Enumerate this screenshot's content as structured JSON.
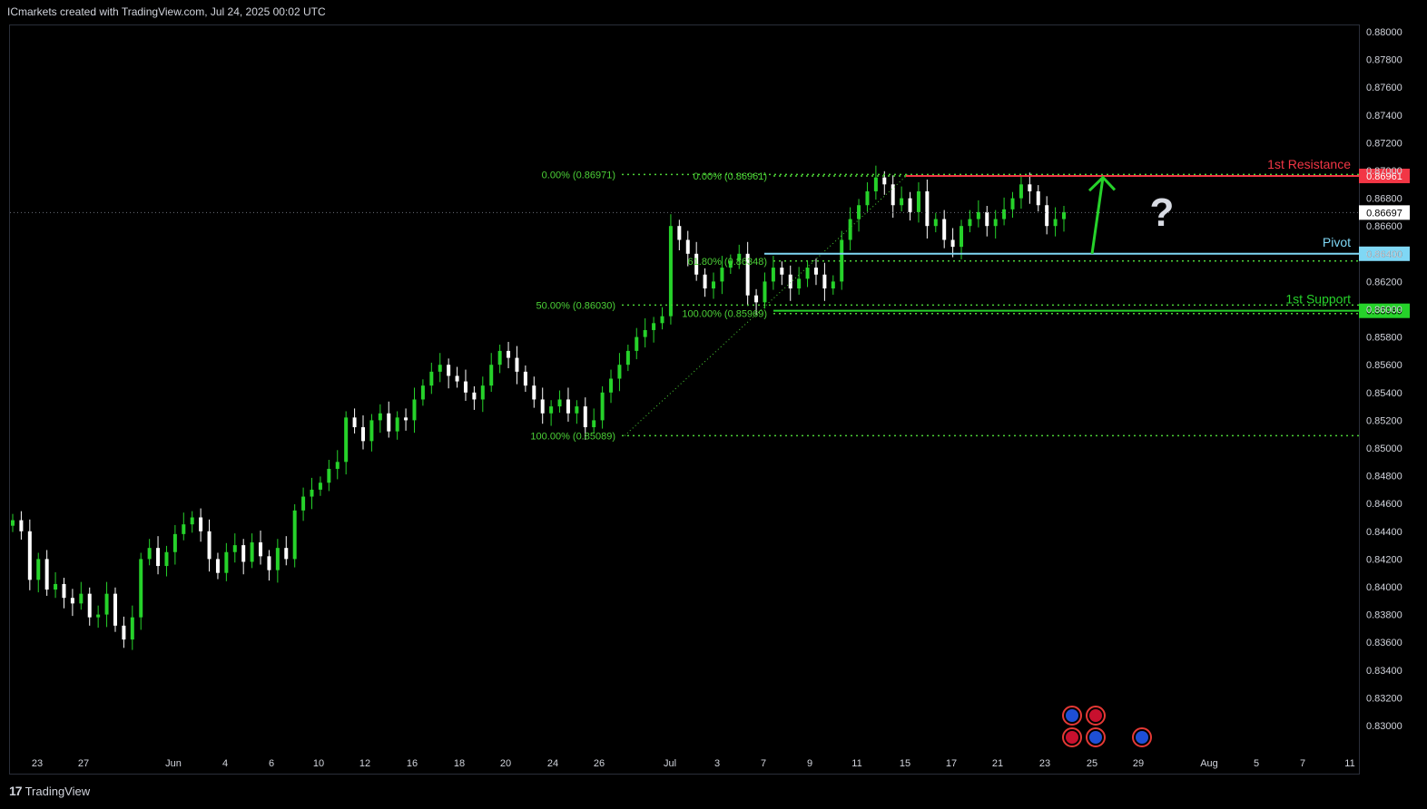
{
  "header": {
    "attribution": "ICmarkets created with TradingView.com, Jul 24, 2025 00:02 UTC"
  },
  "footer": {
    "brand": "TradingView",
    "logo_glyph": "17"
  },
  "colors": {
    "up": "#26d22a",
    "down": "#ffffff",
    "resistance": "#f23645",
    "pivot": "#7fd7f5",
    "support": "#26d22a",
    "fib": "#4cd137",
    "grid": "#2a2e39",
    "background": "#000000"
  },
  "chart_data": {
    "type": "candlestick",
    "title": "",
    "xlabel": "",
    "ylabel": "",
    "y_ticks": [
      "0.88000",
      "0.87800",
      "0.87600",
      "0.87400",
      "0.87200",
      "0.87000",
      "0.86800",
      "0.86600",
      "0.86400",
      "0.86200",
      "0.86000",
      "0.85800",
      "0.85600",
      "0.85400",
      "0.85200",
      "0.85000",
      "0.84800",
      "0.84600",
      "0.84400",
      "0.84200",
      "0.84000",
      "0.83800",
      "0.83600",
      "0.83400",
      "0.83200",
      "0.83000"
    ],
    "x_ticks": [
      "23",
      "27",
      "Jun",
      "4",
      "6",
      "10",
      "12",
      "16",
      "18",
      "20",
      "24",
      "26",
      "Jul",
      "3",
      "7",
      "9",
      "11",
      "15",
      "17",
      "21",
      "23",
      "25",
      "29",
      "Aug",
      "5",
      "7",
      "11"
    ],
    "ylim": [
      0.8293,
      0.8802
    ],
    "current_price": "0.86697",
    "levels": [
      {
        "name": "1st Resistance",
        "price": 0.86961,
        "label": "0.86961",
        "color": "resistance"
      },
      {
        "name": "Pivot",
        "price": 0.864,
        "label": "0.86400",
        "color": "pivot"
      },
      {
        "name": "1st Support",
        "price": 0.85989,
        "label": "0.85989",
        "color": "support"
      }
    ],
    "fib_left": [
      {
        "label": "0.00% (0.86971)",
        "price": 0.86971
      },
      {
        "label": "50.00% (0.86030)",
        "price": 0.8603
      },
      {
        "label": "100.00% (0.85089)",
        "price": 0.85089
      }
    ],
    "fib_right": [
      {
        "label": "0.00% (0.86961)",
        "price": 0.86961
      },
      {
        "label": "61.80% (0.86348)",
        "price": 0.86348
      },
      {
        "label": "100.00% (0.85969)",
        "price": 0.85969
      }
    ],
    "question_mark": "?",
    "close_path": [
      0.8448,
      0.844,
      0.8405,
      0.842,
      0.8398,
      0.8402,
      0.8392,
      0.8388,
      0.8395,
      0.8378,
      0.838,
      0.8395,
      0.8372,
      0.8362,
      0.8378,
      0.842,
      0.8428,
      0.8415,
      0.8425,
      0.8438,
      0.8445,
      0.845,
      0.844,
      0.842,
      0.841,
      0.8425,
      0.843,
      0.8418,
      0.8432,
      0.8422,
      0.8412,
      0.8428,
      0.842,
      0.8455,
      0.8465,
      0.847,
      0.8475,
      0.8485,
      0.849,
      0.8522,
      0.8515,
      0.8505,
      0.852,
      0.8525,
      0.8512,
      0.8522,
      0.852,
      0.8535,
      0.8545,
      0.8555,
      0.856,
      0.8552,
      0.8548,
      0.854,
      0.8535,
      0.8545,
      0.856,
      0.857,
      0.8565,
      0.8555,
      0.8545,
      0.8535,
      0.8525,
      0.853,
      0.8535,
      0.8525,
      0.853,
      0.8515,
      0.852,
      0.854,
      0.855,
      0.856,
      0.857,
      0.858,
      0.8585,
      0.859,
      0.8595,
      0.866,
      0.865,
      0.864,
      0.8625,
      0.8615,
      0.862,
      0.863,
      0.8635,
      0.864,
      0.861,
      0.8605,
      0.862,
      0.863,
      0.8625,
      0.8615,
      0.8622,
      0.863,
      0.8625,
      0.8615,
      0.862,
      0.865,
      0.8665,
      0.8675,
      0.8685,
      0.8695,
      0.869,
      0.8675,
      0.868,
      0.867,
      0.8685,
      0.866,
      0.8665,
      0.865,
      0.8645,
      0.866,
      0.8665,
      0.867,
      0.866,
      0.8665,
      0.8672,
      0.868,
      0.869,
      0.8685,
      0.8675,
      0.866,
      0.8665,
      0.867
    ]
  }
}
